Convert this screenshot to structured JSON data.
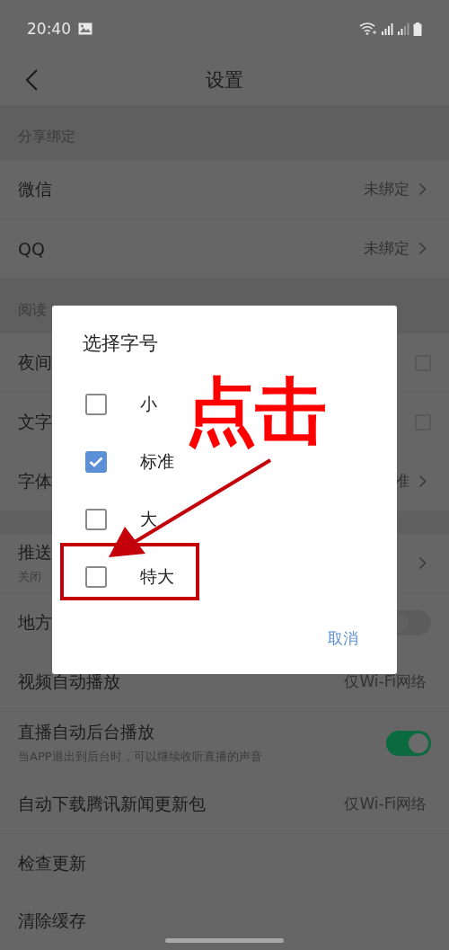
{
  "status_bar": {
    "time": "20:40"
  },
  "header": {
    "title": "设置"
  },
  "sections": [
    {
      "title": "分享绑定",
      "rows": [
        {
          "kind": "link",
          "label": "微信",
          "value": "未绑定"
        },
        {
          "kind": "link",
          "label": "QQ",
          "value": "未绑定"
        }
      ]
    },
    {
      "title": "阅读",
      "rows": [
        {
          "kind": "checkbox",
          "label": "夜间",
          "checked": false
        },
        {
          "kind": "checkbox",
          "label": "文字",
          "checked": false
        },
        {
          "kind": "link",
          "label": "字体",
          "value": "准"
        }
      ]
    },
    {
      "rows": [
        {
          "kind": "link",
          "label": "推送",
          "sublabel": "关闭"
        },
        {
          "kind": "toggle",
          "label": "地方",
          "on": false
        },
        {
          "kind": "value",
          "label": "视频自动播放",
          "value": "仅Wi-Fi网络"
        },
        {
          "kind": "toggle",
          "label": "直播自动后台播放",
          "sublabel": "当APP退出到后台时，可以继续收听直播的声音",
          "on": true
        },
        {
          "kind": "value",
          "label": "自动下载腾讯新闻更新包",
          "value": "仅Wi-Fi网络"
        },
        {
          "kind": "plain",
          "label": "检查更新"
        },
        {
          "kind": "plain",
          "label": "清除缓存"
        }
      ]
    }
  ],
  "dialog": {
    "title": "选择字号",
    "options": [
      {
        "label": "小",
        "selected": false
      },
      {
        "label": "标准",
        "selected": true
      },
      {
        "label": "大",
        "selected": false
      },
      {
        "label": "特大",
        "selected": false
      }
    ],
    "cancel": "取消"
  },
  "annotation": {
    "text": "点击"
  }
}
